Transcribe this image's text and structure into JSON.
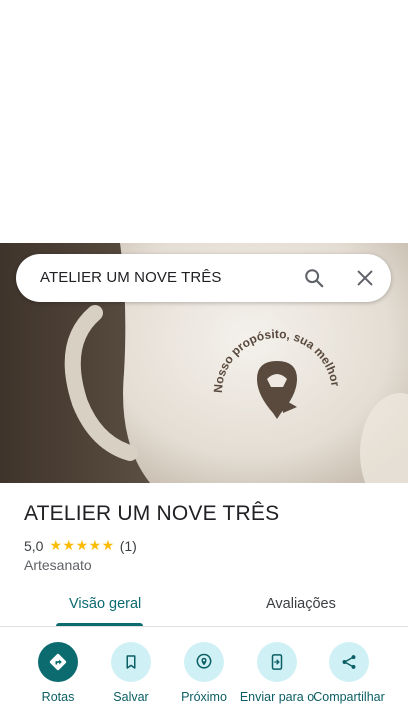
{
  "search": {
    "query": "ATELIER UM NOVE TRÊS"
  },
  "hero_image": {
    "mug_print_text": "Nosso propósito, sua melhor experiência"
  },
  "place": {
    "title": "ATELIER UM NOVE TRÊS",
    "rating": "5,0",
    "stars": "★★★★★",
    "review_count": "(1)",
    "category": "Artesanato"
  },
  "tabs": [
    {
      "label": "Visão geral",
      "active": true
    },
    {
      "label": "Avaliações",
      "active": false
    }
  ],
  "actions": [
    {
      "label": "Rotas",
      "icon": "directions-icon"
    },
    {
      "label": "Salvar",
      "icon": "bookmark-icon"
    },
    {
      "label": "Próximo",
      "icon": "nearby-icon"
    },
    {
      "label": "Enviar para o",
      "icon": "send-to-phone-icon"
    },
    {
      "label": "Compartilhar",
      "icon": "share-icon"
    }
  ],
  "colors": {
    "accent": "#0b6b6f",
    "action_bg": "#cff1f5",
    "star": "#fbbc04"
  }
}
